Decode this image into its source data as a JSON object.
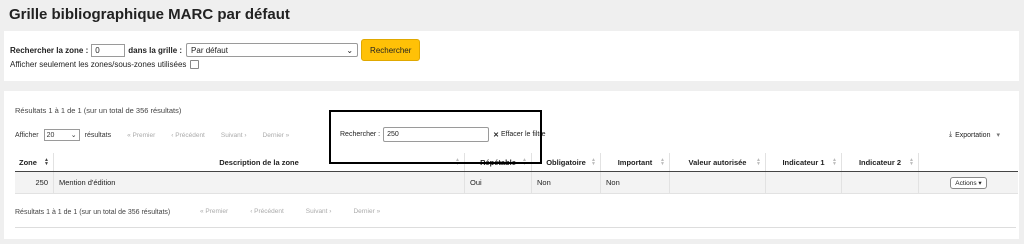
{
  "title": "Grille bibliographique MARC par défaut",
  "search": {
    "zone_label": "Rechercher la zone :",
    "zone_value": "0",
    "in_grid_label": "dans la grille :",
    "grid_selected": "Par défaut",
    "search_button": "Rechercher",
    "only_used_label": "Afficher seulement les zones/sous-zones utilisées"
  },
  "results": {
    "info_top": "Résultats 1 à 1 de 1 (sur un total de 356 résultats)",
    "show_label": "Afficher",
    "show_value": "20",
    "results_label": "résultats",
    "pagination": {
      "first": "« Premier",
      "prev": "‹ Précédent",
      "next": "Suivant ›",
      "last": "Dernier »"
    },
    "filter_label": "Rechercher :",
    "filter_value": "250",
    "clear_filter": "Effacer le filtre",
    "export": "Exportation",
    "columns": [
      "Zone",
      "Description de la zone",
      "Répétable",
      "Obligatoire",
      "Important",
      "Valeur autorisée",
      "Indicateur 1",
      "Indicateur 2",
      ""
    ],
    "rows": [
      {
        "zone": "250",
        "description": "Mention d'édition",
        "repetable": "Oui",
        "obligatoire": "Non",
        "important": "Non",
        "valeur": "",
        "ind1": "",
        "ind2": "",
        "actions": "Actions"
      }
    ],
    "info_bottom": "Résultats 1 à 1 de 1 (sur un total de 356 résultats)",
    "pagination_bottom": {
      "first": "« Premier",
      "prev": "‹ Précédent",
      "next": "Suivant ›",
      "last": "Dernier »"
    }
  },
  "icons": {
    "clear": "x-icon",
    "export": "download-icon",
    "sort": "sort-icon"
  },
  "colors": {
    "primary_button": "#ffc107"
  }
}
